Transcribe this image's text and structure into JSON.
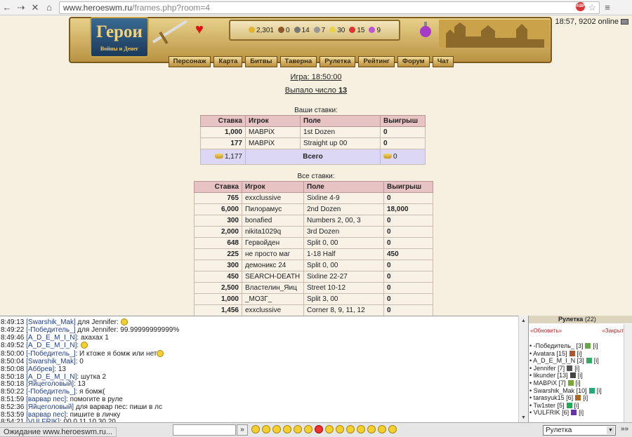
{
  "browser": {
    "url_host": "www.heroeswm.ru",
    "url_path": "/frames.php?room=4",
    "status": "Ожидание www.heroeswm.ru...",
    "abp": "ABP"
  },
  "header": {
    "logo_title": "Герои",
    "logo_subtitle": "Войны и Денег",
    "clock": "18:57, 9202 online",
    "resources": [
      "2,301",
      "0",
      "14",
      "7",
      "30",
      "15",
      "9"
    ],
    "menu": [
      "Персонаж",
      "Карта",
      "Битвы",
      "Таверна",
      "Рулетка",
      "Рейтинг",
      "Форум",
      "Чат"
    ]
  },
  "game": {
    "time_label": "Игра: 18:50:00",
    "result_label": "Выпало число",
    "result_number": "13"
  },
  "my_bets": {
    "title": "Ваши ставки:",
    "headers": [
      "Ставка",
      "Игрок",
      "Поле",
      "Выигрыш"
    ],
    "rows": [
      [
        "1,000",
        "MABPiX",
        "1st Dozen",
        "0"
      ],
      [
        "177",
        "MABPiX",
        "Straight up 00",
        "0"
      ]
    ],
    "total_bet": "1,177",
    "total_label": "Всего",
    "total_win": "0"
  },
  "all_bets": {
    "title": "Все ставки:",
    "headers": [
      "Ставка",
      "Игрок",
      "Поле",
      "Выигрыш"
    ],
    "rows": [
      [
        "765",
        "exxclussive",
        "Sixline 4-9",
        "0"
      ],
      [
        "6,000",
        "Пилорамус",
        "2nd Dozen",
        "18,000"
      ],
      [
        "300",
        "bonafied",
        "Numbers 2, 00, 3",
        "0"
      ],
      [
        "2,000",
        "nikita1029q",
        "3rd Dozen",
        "0"
      ],
      [
        "648",
        "Гервойден",
        "Split 0, 00",
        "0"
      ],
      [
        "225",
        "не просто маг",
        "1-18 Half",
        "450"
      ],
      [
        "300",
        "демоникс 24",
        "Split 0, 00",
        "0"
      ],
      [
        "450",
        "SEARCH-DEATH",
        "Sixline 22-27",
        "0"
      ],
      [
        "2,500",
        "Властелин_Яиц",
        "Street 10-12",
        "0"
      ],
      [
        "1,000",
        "_MO3Г_",
        "Split 3, 00",
        "0"
      ],
      [
        "1,456",
        "exxclussive",
        "Corner 8, 9, 11, 12",
        "0"
      ]
    ]
  },
  "chat": [
    {
      "time": "8:49:13",
      "nick": "[Swarshik_Mak]",
      "text": " для Jennifer: "
    },
    {
      "time": "8:49:22",
      "nick": "[-Победитель_]",
      "text": " для Jennifer: 99.99999999999%"
    },
    {
      "time": "8:49:46",
      "nick": "[A_D_E_M_I_N]",
      "text": ": ахахах 1"
    },
    {
      "time": "8:49:52",
      "nick": "[A_D_E_M_I_N]",
      "text": ": "
    },
    {
      "time": "8:50:00",
      "nick": "[-Победитель_]",
      "text": ": И ктожe я бомж или нет"
    },
    {
      "time": "8:50:04",
      "nick": "[Swarshik_Mak]",
      "text": ": 0"
    },
    {
      "time": "8:50:08",
      "nick": "[Аббрев]",
      "text": ": 13"
    },
    {
      "time": "8:50:18",
      "nick": "[A_D_E_M_I_N]",
      "text": ": шутка 2"
    },
    {
      "time": "8:50:18",
      "nick": "[Яйцеголовый]",
      "text": ": 13"
    },
    {
      "time": "8:50:22",
      "nick": "[-Победитель_]",
      "text": ": я бомж("
    },
    {
      "time": "8:51:59",
      "nick": "[варвар пес]",
      "text": ": помогите в руле"
    },
    {
      "time": "8:52:36",
      "nick": "[Яйцеголовый]",
      "text": " для варвар пес: пиши в лс"
    },
    {
      "time": "8:53:59",
      "nick": "[варвар пес]",
      "text": ": пишите в личку"
    },
    {
      "time": "8:54:21",
      "nick": "[VULFRIK]",
      "text": ": 00 0 11 10 30 20"
    }
  ],
  "side": {
    "room_title": "Рулетка",
    "count": "(22)",
    "refresh": "«Обновить»",
    "close": "«Закрыть»",
    "users": [
      "-Победитель_ [3]",
      "Avatara [15]",
      "A_D_E_M_I_N [3]",
      "Jennifer [7]",
      "likunder [13]",
      "MABPiX [7]",
      "Swarshik_Mak [10]",
      "tarasyuk15 [6]",
      "Tw1ster [5]",
      "VULFRIK [6]"
    ],
    "info": "[i]"
  },
  "input": {
    "send": "»",
    "room_select": "Рулетка",
    "forward": "»»"
  },
  "colors": {
    "accent": "#e8c3c3",
    "total_row": "#dcd7f4",
    "banner": "#c9a24a"
  }
}
